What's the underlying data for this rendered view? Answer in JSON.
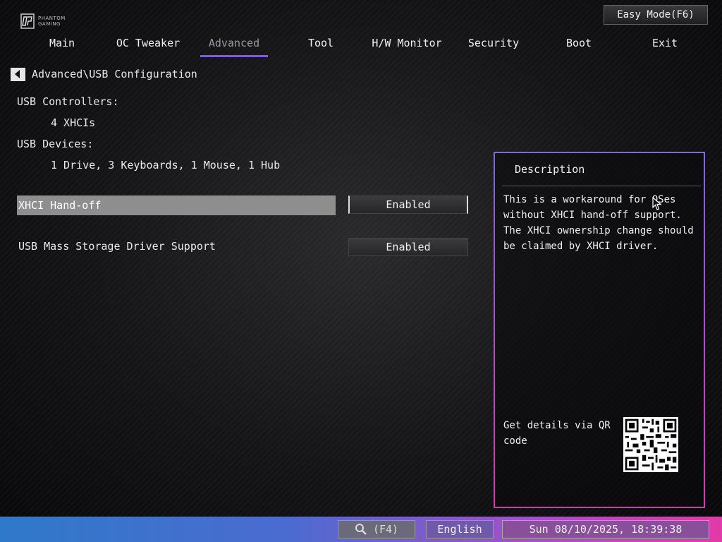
{
  "header": {
    "logo_name": "phantom-gaming-logo",
    "easy_mode_label": "Easy Mode(F6)"
  },
  "tabs": [
    {
      "label": "Main"
    },
    {
      "label": "OC Tweaker"
    },
    {
      "label": "Advanced"
    },
    {
      "label": "Tool"
    },
    {
      "label": "H/W Monitor"
    },
    {
      "label": "Security"
    },
    {
      "label": "Boot"
    },
    {
      "label": "Exit"
    }
  ],
  "active_tab": "Advanced",
  "breadcrumb": "Advanced\\USB Configuration",
  "info": {
    "controllers_label": "USB Controllers:",
    "controllers_value": "4 XHCIs",
    "devices_label": "USB Devices:",
    "devices_value": "1 Drive, 3 Keyboards, 1 Mouse, 1 Hub"
  },
  "settings": [
    {
      "label": "XHCI Hand-off",
      "value": "Enabled"
    },
    {
      "label": "USB Mass Storage Driver Support",
      "value": "Enabled"
    }
  ],
  "description": {
    "title": "Description",
    "text": "This is a workaround for OSes without XHCI hand-off support. The XHCI ownership change should be claimed by XHCI driver.",
    "qr_label": "Get details via QR code"
  },
  "footer": {
    "search_label": "(F4)",
    "language": "English",
    "datetime": "Sun 08/10/2025, 18:39:38"
  },
  "colors": {
    "accent": "#7b61c9",
    "highlight_row": "#8e8e8e",
    "bottom_left": "#2f79c9",
    "bottom_right": "#e23aa8"
  }
}
